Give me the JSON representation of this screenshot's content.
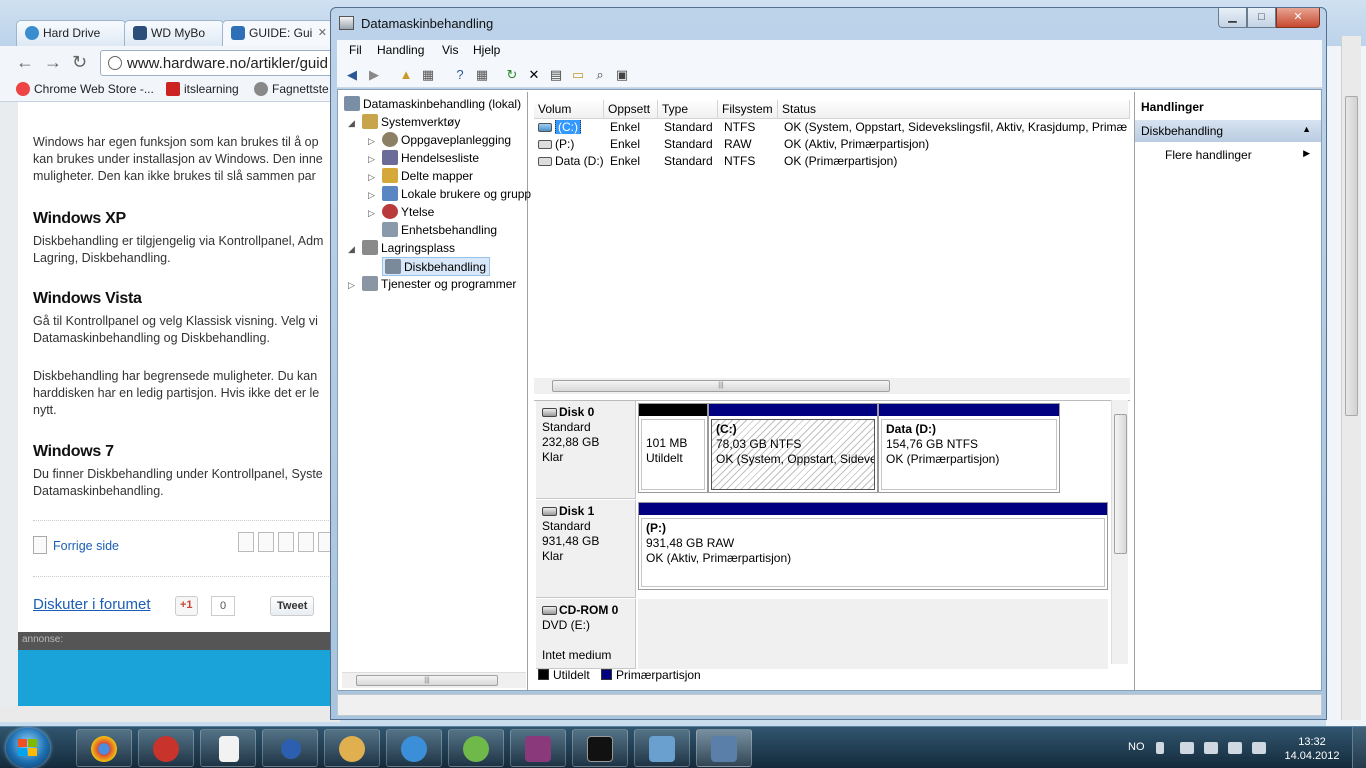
{
  "browser": {
    "tabs": [
      {
        "title": "Hard Drive",
        "fav": "#3a8ed0"
      },
      {
        "title": "WD MyBo",
        "fav": "#2c4d7a"
      },
      {
        "title": "GUIDE: Gui",
        "fav": "#2e6fb7"
      }
    ],
    "url": "www.hardware.no/artikler/guid",
    "bookmarks": [
      "Chrome Web Store -...",
      "itslearning",
      "Fagnettste"
    ],
    "article": {
      "intro": [
        "Windows har egen funksjon som kan brukes til å op",
        "kan brukes under installasjon av Windows. Den inne",
        "muligheter. Den kan ikke brukes til slå sammen par"
      ],
      "xp_heading": "Windows XP",
      "xp_text": [
        "Diskbehandling er tilgjengelig via Kontrollpanel, Adm",
        "Lagring, Diskbehandling."
      ],
      "vista_heading": "Windows Vista",
      "vista_text": [
        "Gå til Kontrollpanel og velg Klassisk visning. Velg vi",
        "Datamaskinbehandling og Diskbehandling."
      ],
      "vista_text2": [
        "Diskbehandling har begrensede muligheter. Du kan",
        "harddisken har en ledig partisjon. Hvis ikke det er le",
        "nytt."
      ],
      "win7_heading": "Windows 7",
      "win7_text": [
        "Du finner Diskbehandling under Kontrollpanel, Syste",
        "Datamaskinbehandling."
      ],
      "prev_link": "Forrige side",
      "forum_link": "Diskuter i forumet",
      "gplus": "+1",
      "gcount": "0",
      "tweet": "Tweet",
      "annonse": "annonse:"
    }
  },
  "mmc": {
    "title": "Datamaskinbehandling",
    "menu": [
      "Fil",
      "Handling",
      "Vis",
      "Hjelp"
    ],
    "tree": [
      {
        "label": "Datamaskinbehandling (lokal)",
        "level": 0,
        "arrow": "",
        "icon": "#7a8ea6"
      },
      {
        "label": "Systemverktøy",
        "level": 1,
        "arrow": "◢",
        "icon": "#c8a44a"
      },
      {
        "label": "Oppgaveplanlegging",
        "level": 2,
        "arrow": "▷",
        "icon": "#8b7f66"
      },
      {
        "label": "Hendelsesliste",
        "level": 2,
        "arrow": "▷",
        "icon": "#6b6b9a"
      },
      {
        "label": "Delte mapper",
        "level": 2,
        "arrow": "▷",
        "icon": "#d4a93a"
      },
      {
        "label": "Lokale brukere og grupp",
        "level": 2,
        "arrow": "▷",
        "icon": "#5a86c4"
      },
      {
        "label": "Ytelse",
        "level": 2,
        "arrow": "▷",
        "icon": "#b83a3a"
      },
      {
        "label": "Enhetsbehandling",
        "level": 2,
        "arrow": "",
        "icon": "#8a9aab"
      },
      {
        "label": "Lagringsplass",
        "level": 1,
        "arrow": "◢",
        "icon": "#8a8a8a"
      },
      {
        "label": "Diskbehandling",
        "level": 2,
        "arrow": "",
        "icon": "#7a8a9a",
        "selected": true
      },
      {
        "label": "Tjenester og programmer",
        "level": 1,
        "arrow": "▷",
        "icon": "#8a96a4"
      }
    ],
    "columns": [
      "Volum",
      "Oppsett",
      "Type",
      "Filsystem",
      "Status"
    ],
    "volumes": [
      {
        "volum": "(C:)",
        "oppsett": "Enkel",
        "type": "Standard",
        "filsystem": "NTFS",
        "status": "OK (System, Oppstart, Sidevekslingsfil, Aktiv, Krasjdump, Primær",
        "selected": true
      },
      {
        "volum": "(P:)",
        "oppsett": "Enkel",
        "type": "Standard",
        "filsystem": "RAW",
        "status": "OK (Aktiv, Primærpartisjon)"
      },
      {
        "volum": "Data (D:)",
        "oppsett": "Enkel",
        "type": "Standard",
        "filsystem": "NTFS",
        "status": "OK (Primærpartisjon)"
      }
    ],
    "disks": [
      {
        "name": "Disk 0",
        "kind": "Standard",
        "size": "232,88 GB",
        "state": "Klar",
        "parts": [
          {
            "title": "",
            "line1": "101 MB",
            "line2": "Utildelt",
            "color": "#000000"
          },
          {
            "title": "(C:)",
            "line1": "78,03 GB NTFS",
            "line2": "OK (System, Oppstart, Sidevel",
            "color": "#000080",
            "hatched": true
          },
          {
            "title": "Data  (D:)",
            "line1": "154,76 GB NTFS",
            "line2": "OK (Primærpartisjon)",
            "color": "#000080"
          }
        ]
      },
      {
        "name": "Disk 1",
        "kind": "Standard",
        "size": "931,48 GB",
        "state": "Klar",
        "parts": [
          {
            "title": "(P:)",
            "line1": "931,48 GB RAW",
            "line2": "OK (Aktiv, Primærpartisjon)",
            "color": "#000080"
          }
        ]
      },
      {
        "name": "CD-ROM 0",
        "kind": "DVD (E:)",
        "size": "",
        "state": "Intet medium",
        "parts": []
      }
    ],
    "legend": [
      {
        "label": "Utildelt",
        "color": "#000000"
      },
      {
        "label": "Primærpartisjon",
        "color": "#000080"
      }
    ],
    "actions": {
      "header": "Handlinger",
      "section": "Diskbehandling",
      "item": "Flere handlinger"
    }
  },
  "taskbar": {
    "lang": "NO",
    "time": "13:32",
    "date": "14.04.2012",
    "apps": [
      {
        "name": "chrome-app",
        "color": "#d94a38"
      },
      {
        "name": "ccleaner-app",
        "color": "#c8332b"
      },
      {
        "name": "document-app",
        "color": "#f2f2f2"
      },
      {
        "name": "app-plus",
        "color": "#2d5fb0"
      },
      {
        "name": "paint-app",
        "color": "#e0b050"
      },
      {
        "name": "quicktime-app",
        "color": "#3b8fd9"
      },
      {
        "name": "messenger-app",
        "color": "#6fb84a"
      },
      {
        "name": "winrar-app",
        "color": "#8a3a7a"
      },
      {
        "name": "cmd-app",
        "color": "#111111"
      },
      {
        "name": "control-panel-app",
        "color": "#6aa0d0"
      },
      {
        "name": "computer-management-app",
        "color": "#5a7fa8"
      }
    ]
  }
}
